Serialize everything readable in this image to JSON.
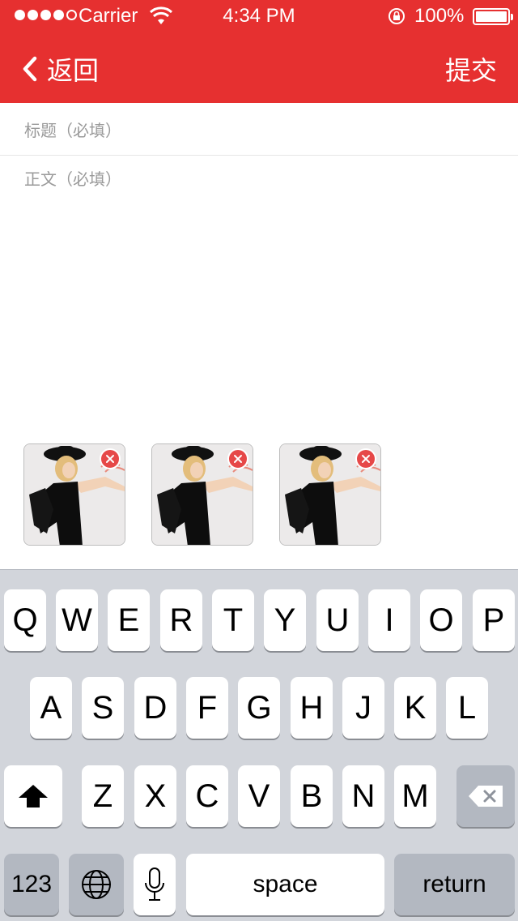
{
  "status_bar": {
    "carrier": "Carrier",
    "time": "4:34 PM",
    "battery": "100%"
  },
  "nav": {
    "back_label": "返回",
    "submit_label": "提交"
  },
  "form": {
    "title_placeholder": "标题（必填）",
    "body_placeholder": "正文（必填）"
  },
  "thumbnails": [
    {
      "remove_icon": "close-icon"
    },
    {
      "remove_icon": "close-icon"
    },
    {
      "remove_icon": "close-icon"
    }
  ],
  "keyboard": {
    "row1": [
      "Q",
      "W",
      "E",
      "R",
      "T",
      "Y",
      "U",
      "I",
      "O",
      "P"
    ],
    "row2": [
      "A",
      "S",
      "D",
      "F",
      "G",
      "H",
      "J",
      "K",
      "L"
    ],
    "row3": [
      "Z",
      "X",
      "C",
      "V",
      "B",
      "N",
      "M"
    ],
    "numbers_label": "123",
    "space_label": "space",
    "return_label": "return"
  },
  "colors": {
    "accent": "#e63030",
    "keyboard_bg": "#d2d5db"
  }
}
